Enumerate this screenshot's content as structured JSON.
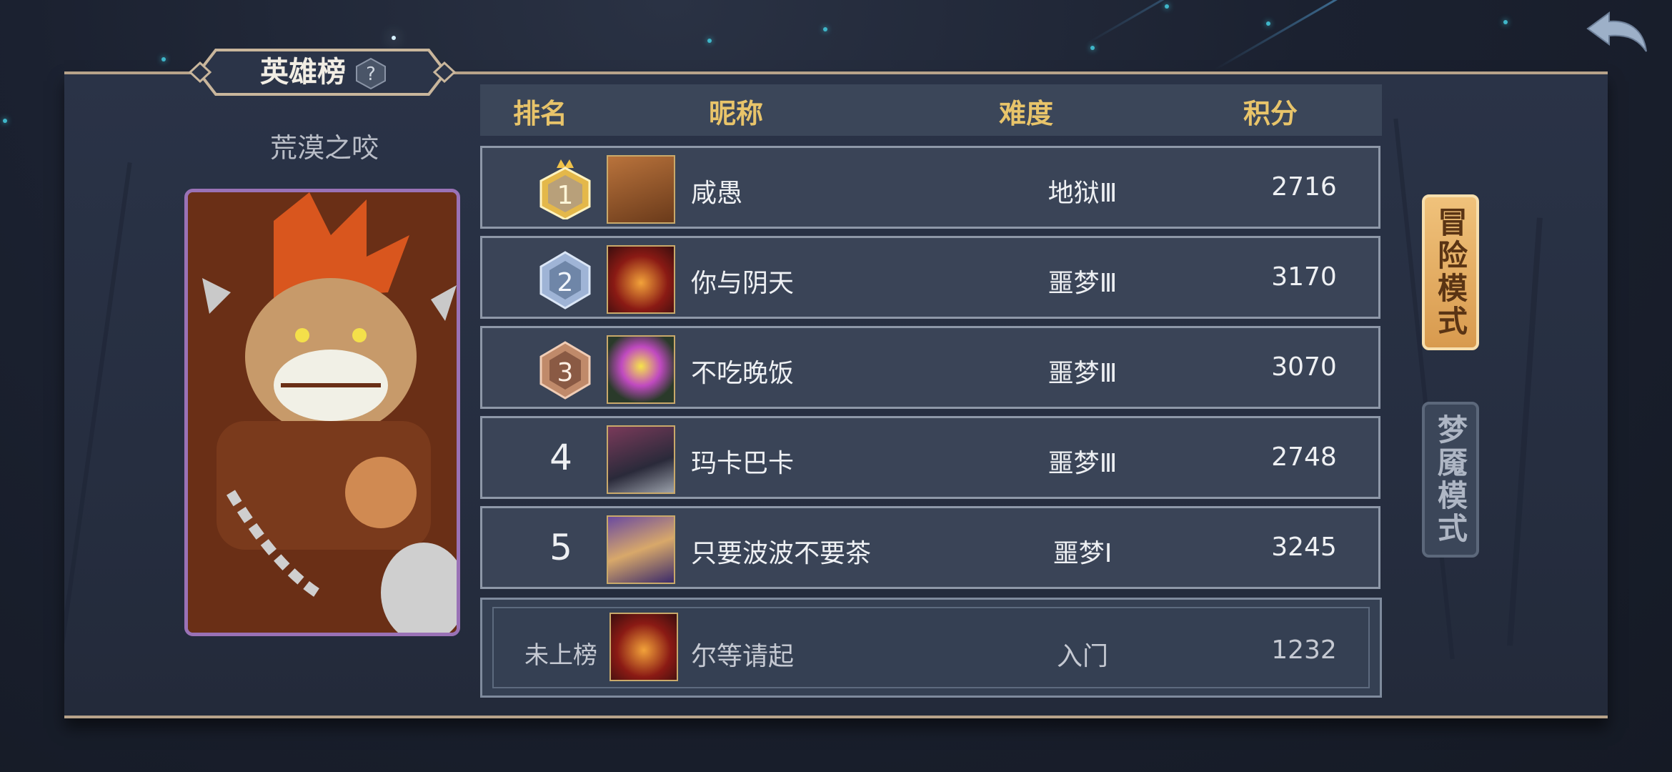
{
  "header": {
    "title": "英雄榜",
    "help_glyph": "?"
  },
  "hero": {
    "name": "荒漠之咬"
  },
  "table": {
    "columns": [
      "排名",
      "昵称",
      "难度",
      "积分"
    ],
    "rows": [
      {
        "rank": "1",
        "nickname": "咸愚",
        "difficulty": "地狱Ⅲ",
        "score": "2716"
      },
      {
        "rank": "2",
        "nickname": "你与阴天",
        "difficulty": "噩梦Ⅲ",
        "score": "3170"
      },
      {
        "rank": "3",
        "nickname": "不吃晚饭",
        "difficulty": "噩梦Ⅲ",
        "score": "3070"
      },
      {
        "rank": "4",
        "nickname": "玛卡巴卡",
        "difficulty": "噩梦Ⅲ",
        "score": "2748"
      },
      {
        "rank": "5",
        "nickname": "只要波波不要茶",
        "difficulty": "噩梦Ⅰ",
        "score": "3245"
      }
    ],
    "self": {
      "rank": "未上榜",
      "nickname": "尔等请起",
      "difficulty": "入门",
      "score": "1232"
    }
  },
  "modes": {
    "adventure": "冒险模式",
    "nightmare": "梦魇模式"
  },
  "icons": {
    "back": "back-arrow-icon",
    "help": "help-icon",
    "gold_rank": "gold-crown-badge-icon",
    "silver_rank": "silver-badge-icon",
    "bronze_rank": "bronze-badge-icon"
  },
  "colors": {
    "accent_gold": "#e8c46a",
    "panel_border": "#b7a38a",
    "card_border": "#9a72b6"
  }
}
